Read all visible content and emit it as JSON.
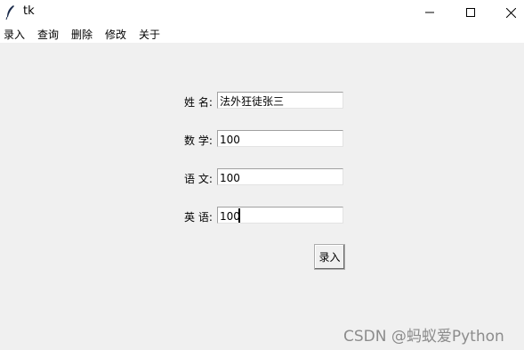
{
  "window": {
    "title": "tk",
    "icon": "feather-icon"
  },
  "titlebar_buttons": {
    "minimize_icon": "minimize-icon",
    "maximize_icon": "maximize-icon",
    "close_icon": "close-icon"
  },
  "menu": {
    "items": [
      {
        "label": "录入"
      },
      {
        "label": "查询"
      },
      {
        "label": "删除"
      },
      {
        "label": "修改"
      },
      {
        "label": "关于"
      }
    ]
  },
  "form": {
    "fields": [
      {
        "label": "姓 名:",
        "value": "法外狂徒张三"
      },
      {
        "label": "数 学:",
        "value": "100"
      },
      {
        "label": "语 文:",
        "value": "100"
      },
      {
        "label": "英 语:",
        "value": "100"
      }
    ],
    "submit_label": "录入"
  },
  "watermark": "CSDN @蚂蚁爱Python",
  "colors": {
    "window_bg": "#f0f0f0",
    "titlebar_bg": "#ffffff",
    "entry_bg": "#ffffff",
    "watermark": "#8c8c8c"
  }
}
